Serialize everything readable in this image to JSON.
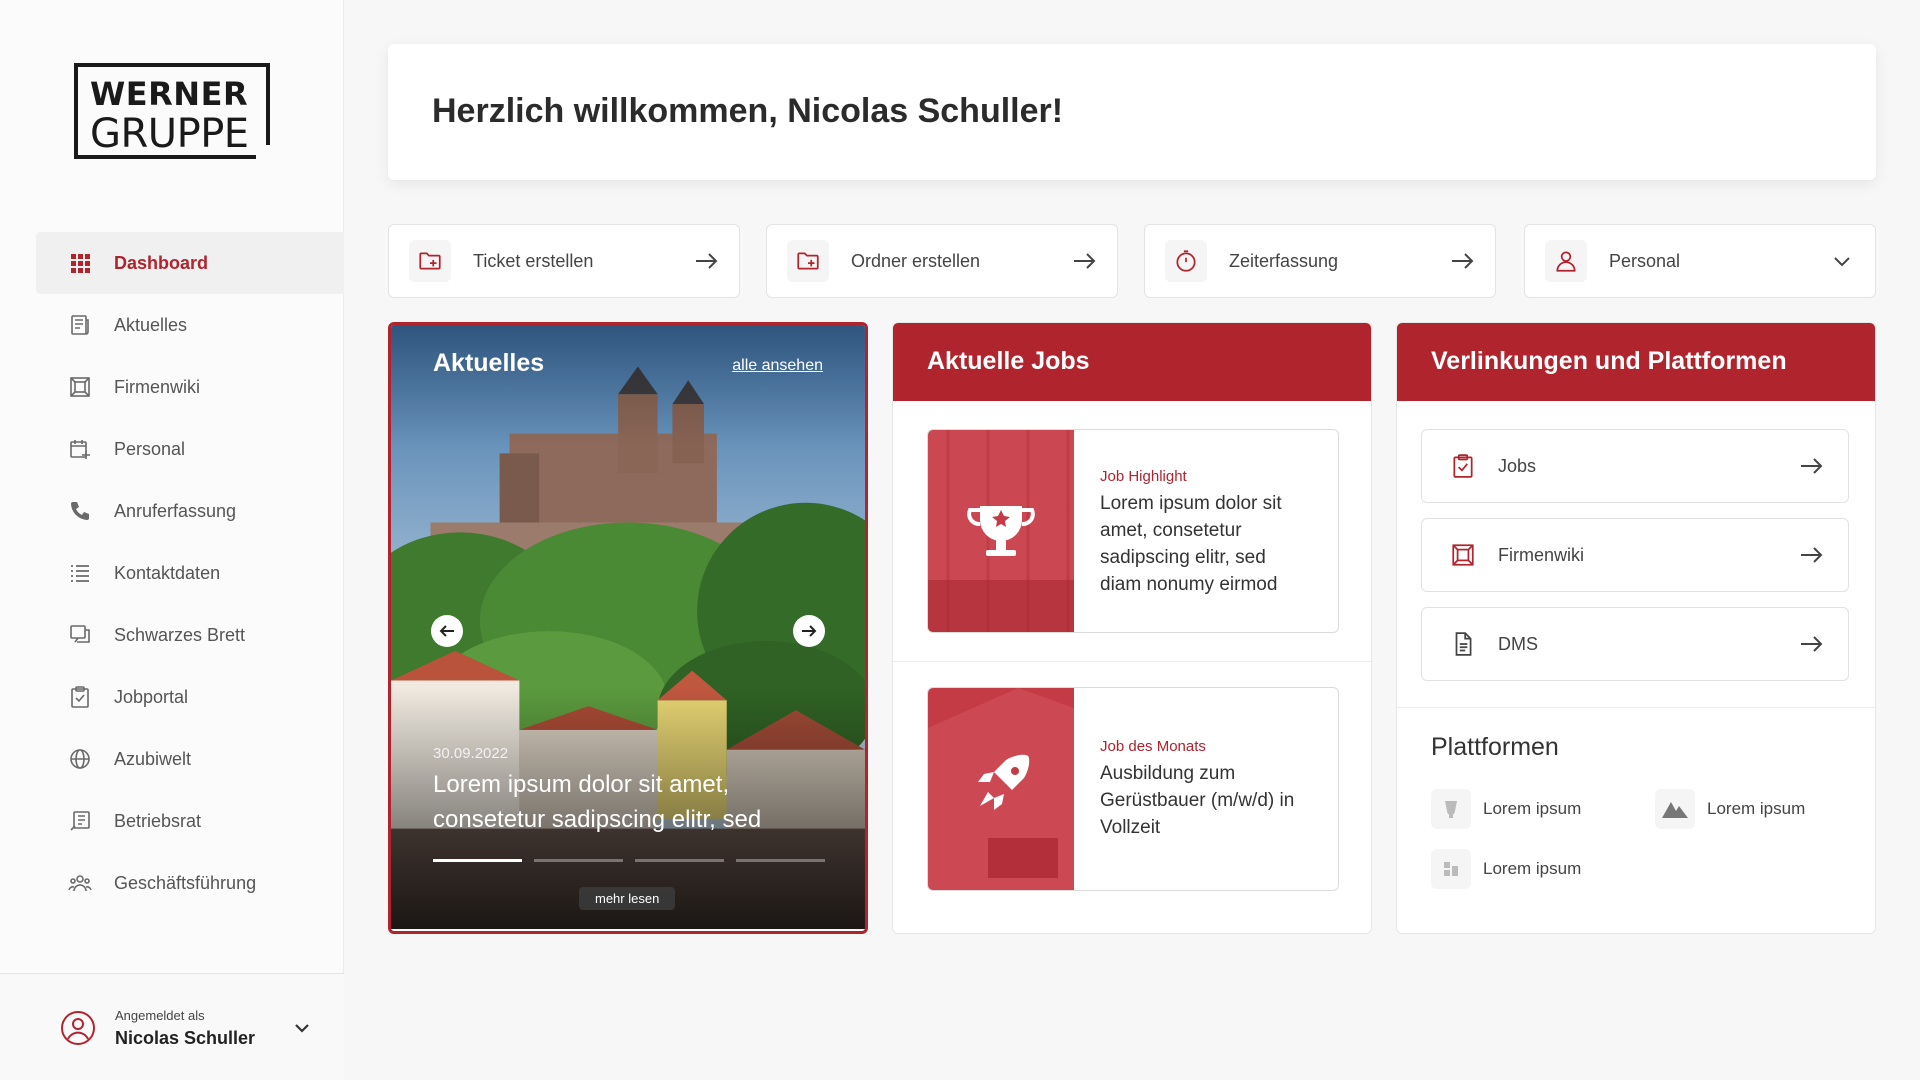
{
  "brand": {
    "logo_line1": "WERNER",
    "logo_line2": "GRUPPE",
    "accent": "#b0242e"
  },
  "sidebar": {
    "items": [
      {
        "label": "Dashboard",
        "icon": "grid-icon",
        "active": true
      },
      {
        "label": "Aktuelles",
        "icon": "newspaper-icon"
      },
      {
        "label": "Firmenwiki",
        "icon": "wiki-icon"
      },
      {
        "label": "Personal",
        "icon": "calendar-plus-icon"
      },
      {
        "label": "Anruferfassung",
        "icon": "phone-icon"
      },
      {
        "label": "Kontaktdaten",
        "icon": "list-icon"
      },
      {
        "label": "Schwarzes Brett",
        "icon": "board-icon"
      },
      {
        "label": "Jobportal",
        "icon": "clipboard-icon"
      },
      {
        "label": "Azubiwelt",
        "icon": "globe-icon"
      },
      {
        "label": "Betriebsrat",
        "icon": "document-icon"
      },
      {
        "label": "Geschäftsführung",
        "icon": "people-icon"
      }
    ],
    "user": {
      "prefix": "Angemeldet als",
      "name": "Nicolas Schuller"
    }
  },
  "header": {
    "welcome": "Herzlich willkommen, Nicolas Schuller!"
  },
  "quick_actions": [
    {
      "label": "Ticket erstellen",
      "icon": "folder-plus-icon",
      "trailing": "arrow-right-icon"
    },
    {
      "label": "Ordner erstellen",
      "icon": "folder-plus-icon",
      "trailing": "arrow-right-icon"
    },
    {
      "label": "Zeiterfassung",
      "icon": "stopwatch-icon",
      "trailing": "arrow-right-icon"
    },
    {
      "label": "Personal",
      "icon": "user-icon",
      "trailing": "chevron-down-icon"
    }
  ],
  "news": {
    "title": "Aktuelles",
    "all_link": "alle ansehen",
    "date": "30.09.2022",
    "headline": "Lorem ipsum dolor sit amet, consetetur sadipscing elitr, sed",
    "more": "mehr lesen",
    "slides": 4,
    "active_slide": 1
  },
  "jobs": {
    "title": "Aktuelle Jobs",
    "items": [
      {
        "category": "Job Highlight",
        "text": "Lorem ipsum dolor sit amet, consetetur sadipscing elitr, sed diam nonumy eirmod",
        "icon": "trophy-icon"
      },
      {
        "category": "Job des Monats",
        "text": "Ausbildung zum Gerüstbauer (m/w/d) in Vollzeit",
        "icon": "rocket-icon"
      }
    ]
  },
  "links": {
    "title": "Verlinkungen und Plattformen",
    "items": [
      {
        "label": "Jobs",
        "icon": "clipboard-check-icon"
      },
      {
        "label": "Firmenwiki",
        "icon": "wiki-icon"
      },
      {
        "label": "DMS",
        "icon": "document-icon"
      }
    ],
    "platforms_title": "Plattformen",
    "platforms": [
      {
        "label": "Lorem ipsum",
        "icon": "platform-logo-icon"
      },
      {
        "label": "Lorem ipsum",
        "icon": "mountain-logo-icon"
      },
      {
        "label": "Lorem ipsum",
        "icon": "platform-logo-icon"
      }
    ]
  }
}
